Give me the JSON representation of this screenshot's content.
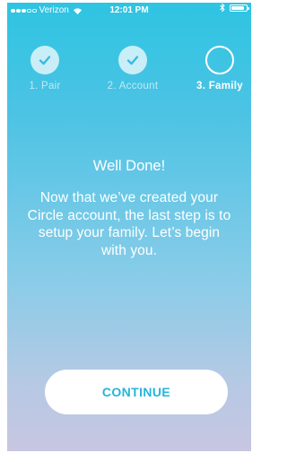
{
  "status_bar": {
    "carrier": "Verizon",
    "time": "12:01 PM",
    "signal_bars_filled": 3,
    "signal_bars_total": 5
  },
  "steps": [
    {
      "label": "1. Pair",
      "state": "complete"
    },
    {
      "label": "2. Account",
      "state": "complete"
    },
    {
      "label": "3. Family",
      "state": "current"
    }
  ],
  "main": {
    "title": "Well Done!",
    "message": "Now that we’ve created your Circle account, the last step is to setup your family.  Let’s begin with you."
  },
  "continue_label": "CONTINUE",
  "colors": {
    "gradient_top": "#2ec4e2",
    "gradient_bottom": "#c8c6e1",
    "button_text": "#25b4dc"
  }
}
